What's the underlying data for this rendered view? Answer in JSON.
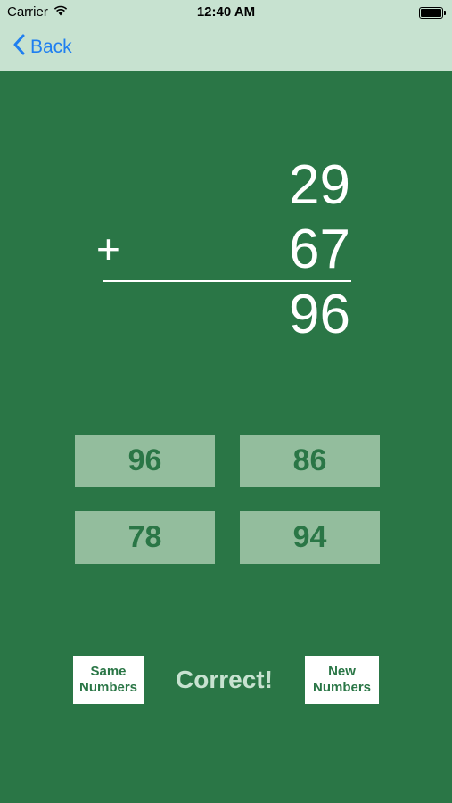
{
  "status": {
    "carrier": "Carrier",
    "time": "12:40 AM"
  },
  "nav": {
    "back_label": "Back"
  },
  "problem": {
    "operand_top": "29",
    "operator": "+",
    "operand_bottom": "67",
    "answer": "96"
  },
  "choices": [
    "96",
    "86",
    "78",
    "94"
  ],
  "controls": {
    "same_line1": "Same",
    "same_line2": "Numbers",
    "new_line1": "New",
    "new_line2": "Numbers",
    "result": "Correct!"
  },
  "colors": {
    "background": "#2a7646",
    "bar": "#c7e2d0",
    "choice": "#93bd9d",
    "link": "#1f7ff0"
  },
  "icons": {
    "wifi": "wifi-icon",
    "battery": "battery-icon",
    "back": "chevron-left-icon"
  }
}
